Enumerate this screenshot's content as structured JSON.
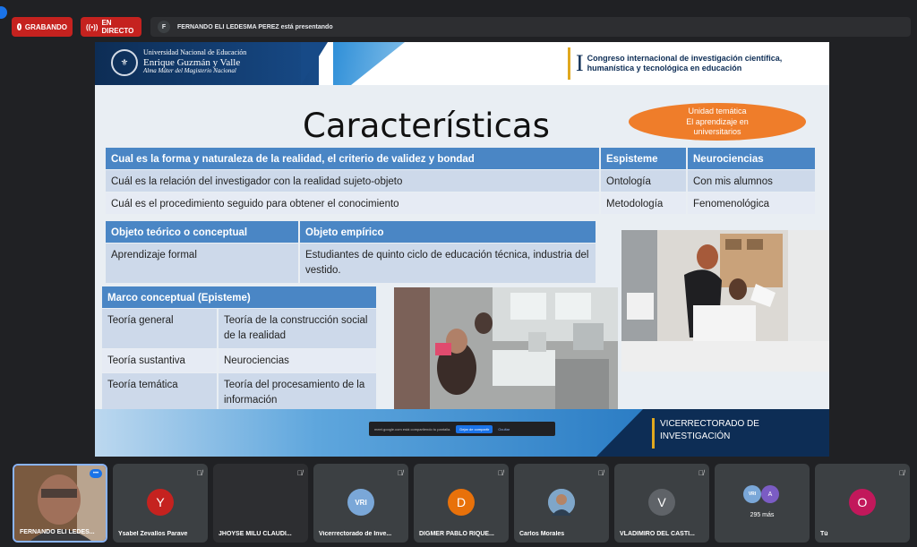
{
  "topbar": {
    "recording_label": "GRABANDO",
    "live_label": "EN DIRECTO",
    "presenter_initial": "F",
    "presenting_text": "FERNANDO ELI LEDESMA PEREZ está presentando"
  },
  "slide": {
    "university": {
      "line1": "Universidad Nacional de Educación",
      "line2": "Enrique Guzmán y Valle",
      "line3": "Alma Máter del Magisterio Nacional"
    },
    "congress": {
      "numeral": "I",
      "line1": "Congreso internacional de investigación científica,",
      "line2": "humanística y tecnológica en educación"
    },
    "title": "Características",
    "unit_oval": {
      "line1": "Unidad temática",
      "line2": "El aprendizaje en",
      "line3": "universitarios"
    },
    "table1": {
      "header": [
        "Cual es la forma y naturaleza de la realidad, el criterio de validez y bondad",
        "Espisteme",
        "Neurociencias"
      ],
      "rows": [
        [
          "Cuál es la relación del investigador con la realidad sujeto-objeto",
          "Ontología",
          "Con mis alumnos"
        ],
        [
          "Cuál es el procedimiento seguido para obtener el conocimiento",
          "Metodología",
          "Fenomenológica"
        ]
      ]
    },
    "table2": {
      "header": [
        "Objeto teórico o conceptual",
        "Objeto empírico"
      ],
      "row": [
        "Aprendizaje formal",
        "Estudiantes de quinto ciclo de educación técnica, industria del vestido."
      ]
    },
    "table3": {
      "header": "Marco conceptual (Episteme)",
      "rows": [
        [
          "Teoría general",
          "Teoría de la construcción social de la realidad"
        ],
        [
          "Teoría sustantiva",
          "Neurociencias"
        ],
        [
          "Teoría temática",
          "Teoría del procesamiento de la información"
        ]
      ]
    },
    "footer": {
      "vicer_line1": "VICERRECTORADO DE",
      "vicer_line2": "INVESTIGACIÓN"
    },
    "share_bar": {
      "text": "meet.google.com está compartiendo tu pantalla.",
      "stop_label": "Dejar de compartir",
      "hide_label": "Ocultar"
    }
  },
  "participants": [
    {
      "name": "FERNANDO ELI LEDES...",
      "type": "video"
    },
    {
      "name": "Ysabel Zevallos Parave",
      "initial": "Y",
      "color": "#c5221f"
    },
    {
      "name": "JHOYSE MILU CLAUDI...",
      "type": "dark"
    },
    {
      "name": "Vicerrectorado de Inve...",
      "initial": "VRI",
      "color": "#7aa7d8"
    },
    {
      "name": "DIGMER PABLO RIQUE...",
      "initial": "D",
      "color": "#e8710a"
    },
    {
      "name": "Carlos Morales",
      "type": "photo"
    },
    {
      "name": "VLADIMIRO DEL CASTI...",
      "initial": "V",
      "color": "#5f6368"
    },
    {
      "more": "295 más"
    },
    {
      "name": "Tú",
      "initial": "O",
      "color": "#c2185b"
    }
  ],
  "colors": {
    "header_blue": "#4a86c5",
    "recording_red": "#c5221f",
    "accent_orange": "#ef7d2a",
    "navy": "#0d2d55"
  }
}
